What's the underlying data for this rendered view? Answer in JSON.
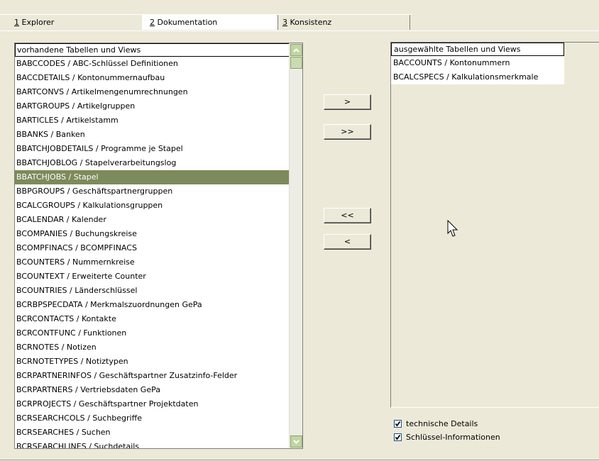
{
  "tabs": [
    {
      "num": "1",
      "label": " Explorer"
    },
    {
      "num": "2",
      "label": " Dokumentation"
    },
    {
      "num": "3",
      "label": " Konsistenz"
    }
  ],
  "available_list": {
    "header": "vorhandene Tabellen und Views",
    "selected_index": 9,
    "items": [
      "BABCCODES / ABC-Schlüssel Definitionen",
      "BACCDETAILS / Kontonummernaufbau",
      "BARTCONVS / Artikelmengenumrechnungen",
      "BARTGROUPS / Artikelgruppen",
      "BARTICLES / Artikelstamm",
      "BBANKS / Banken",
      "BBATCHJOBDETAILS / Programme je Stapel",
      "BBATCHJOBLOG / Stapelverarbeitungslog",
      "BBATCHJOBS / Stapel",
      "BBPGROUPS / Geschäftspartnergruppen",
      "BCALCGROUPS / Kalkulationsgruppen",
      "BCALENDAR / Kalender",
      "BCOMPANIES / Buchungskreise",
      "BCOMPFINACS / BCOMPFINACS",
      "BCOUNTERS / Nummernkreise",
      "BCOUNTEXT / Erweiterte Counter",
      "BCOUNTRIES / Länderschlüssel",
      "BCRBPSPECDATA / Merkmalszuordnungen GePa",
      "BCRCONTACTS / Kontakte",
      "BCRCONTFUNC / Funktionen",
      "BCRNOTES / Notizen",
      "BCRNOTETYPES / Notiztypen",
      "BCRPARTNERINFOS / Geschäftspartner Zusatzinfo-Felder",
      "BCRPARTNERS / Vertriebsdaten GePa",
      "BCRPROJECTS / Geschäftspartner Projektdaten",
      "BCRSEARCHCOLS / Suchbegriffe",
      "BCRSEARCHES / Suchen",
      "BCRSEARCHLINES / Suchdetails"
    ]
  },
  "buttons": {
    "add_one": ">",
    "add_all": ">>",
    "remove_all": "<<",
    "remove_one": "<"
  },
  "selected_list": {
    "header": "ausgewählte Tabellen und Views",
    "items": [
      "BACCOUNTS / Kontonummern",
      "BCALCSPECS / Kalkulationsmerkmale"
    ]
  },
  "options": {
    "technical_details": {
      "label": "technische Details",
      "checked": true
    },
    "key_info": {
      "label": "Schlüssel-Informationen",
      "checked": true
    }
  },
  "colors": {
    "selection": "#7d8a5b",
    "scrollbar_button": "#c1d6a3",
    "background": "#ece9d8"
  }
}
